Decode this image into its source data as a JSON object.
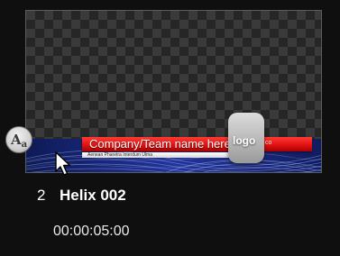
{
  "clip": {
    "index": "2",
    "name": "Helix 002",
    "duration": "00:00:05:00",
    "badge_letter": "A",
    "badge_sub": "a",
    "thumbnail": {
      "title_text": "Company/Team name here",
      "subtitle_text": "Aenean Pharetra Interdum Ulma",
      "logo_text": "logo",
      "logo_dots": "co"
    }
  },
  "colors": {
    "background": "#0f0f0f",
    "accent_red": "#e01212",
    "accent_blue": "#1a2f86"
  },
  "icons": {
    "cursor": "arrow-cursor-icon",
    "badge": "title-text-badge-icon"
  }
}
